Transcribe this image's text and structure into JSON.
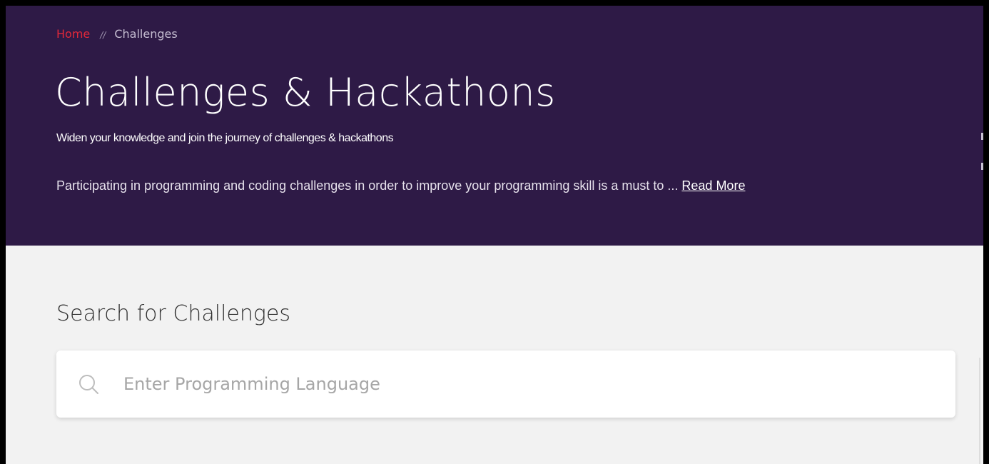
{
  "breadcrumb": {
    "home": "Home",
    "separator": "//",
    "current": "Challenges"
  },
  "hero": {
    "title": "Challenges & Hackathons",
    "subtitle": "Widen your knowledge and join the journey of challenges & hackathons",
    "description": "Participating in programming and coding challenges in order to improve your programming skill is a must to ... ",
    "read_more": "Read More"
  },
  "search": {
    "heading": "Search for Challenges",
    "placeholder": "Enter Programming Language",
    "value": "",
    "icon": "search-icon"
  },
  "colors": {
    "hero_background": "#2e1a46",
    "accent": "#e0283a",
    "page_background": "#f2f2f2"
  }
}
